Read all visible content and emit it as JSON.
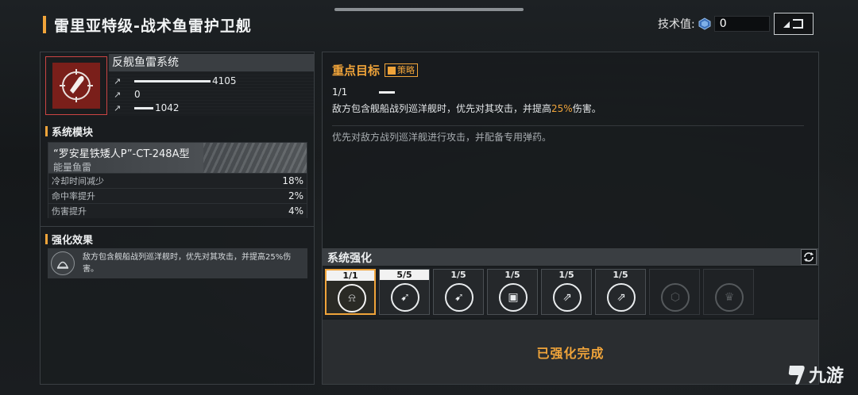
{
  "header": {
    "title": "雷里亚特级-战术鱼雷护卫舰",
    "tech_label": "技术值:",
    "tech_value": "0"
  },
  "weapon": {
    "name": "反舰鱼雷系统",
    "stats": [
      {
        "icon": "damage-icon",
        "value": "4105",
        "fill": 0.75
      },
      {
        "icon": "penetration-icon",
        "value": "0",
        "fill": 0
      },
      {
        "icon": "range-icon",
        "value": "1042",
        "fill": 0.19
      }
    ]
  },
  "module": {
    "section_title": "系统模块",
    "name": "“罗安星铁矮人P”-CT-248A型",
    "type": "能量鱼雷",
    "rows": [
      {
        "label": "冷却时间减少",
        "value": "18%"
      },
      {
        "label": "命中率提升",
        "value": "2%"
      },
      {
        "label": "伤害提升",
        "value": "4%"
      }
    ]
  },
  "enhance_effect": {
    "section_title": "强化效果",
    "text": "敌方包含舰船战列巡洋舰时，优先对其攻击，并提高25%伤害。"
  },
  "focus": {
    "title": "重点目标",
    "tag": "策略",
    "progress": "1/1",
    "desc_pre": "敌方包含舰船战列巡洋舰时，优先对其攻击，并提高",
    "desc_hl": "25%",
    "desc_post": "伤害。",
    "note": "优先对敌方战列巡洋舰进行攻击，并配备专用弹药。"
  },
  "system_enhance": {
    "title": "系统强化",
    "slots": [
      {
        "count": "1/1",
        "icon": "torpedo-bell-icon",
        "state": "active",
        "full": true
      },
      {
        "count": "5/5",
        "icon": "torpedo-rocket-icon",
        "state": "normal",
        "full": true
      },
      {
        "count": "1/5",
        "icon": "torpedo-rocket-icon",
        "state": "normal",
        "full": false
      },
      {
        "count": "1/5",
        "icon": "chip-icon",
        "state": "normal",
        "full": false
      },
      {
        "count": "1/5",
        "icon": "twin-torpedo-icon",
        "state": "normal",
        "full": false
      },
      {
        "count": "1/5",
        "icon": "twin-torpedo-icon",
        "state": "normal",
        "full": false
      },
      {
        "count": "",
        "icon": "cube-icon",
        "state": "locked",
        "full": false
      },
      {
        "count": "",
        "icon": "crown-icon",
        "state": "locked",
        "full": false
      }
    ],
    "complete_label": "已强化完成"
  },
  "watermark": {
    "text": "九游"
  },
  "colors": {
    "accent": "#f0a43a",
    "panel": "#1a1d20",
    "weapon_icon_bg": "#7a1f1a"
  }
}
